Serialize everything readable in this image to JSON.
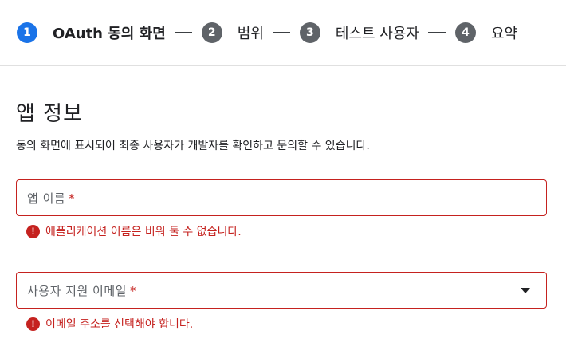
{
  "stepper": {
    "steps": [
      {
        "number": "1",
        "label": "OAuth 동의 화면"
      },
      {
        "number": "2",
        "label": "범위"
      },
      {
        "number": "3",
        "label": "테스트 사용자"
      },
      {
        "number": "4",
        "label": "요약"
      }
    ],
    "active_index": 0
  },
  "app_info": {
    "title": "앱 정보",
    "description": "동의 화면에 표시되어 최종 사용자가 개발자를 확인하고 문의할 수 있습니다."
  },
  "app_name_field": {
    "label": "앱 이름",
    "required_mark": "*",
    "error": "애플리케이션 이름은 비워 둘 수 없습니다."
  },
  "support_email_field": {
    "label": "사용자 지원 이메일",
    "required_mark": "*",
    "error": "이메일 주소를 선택해야 합니다."
  },
  "icons": {
    "error": "error-icon",
    "dropdown": "chevron-down-icon"
  },
  "colors": {
    "active_step": "#1a73e8",
    "inactive_step": "#5f6368",
    "error": "#c5221f"
  }
}
